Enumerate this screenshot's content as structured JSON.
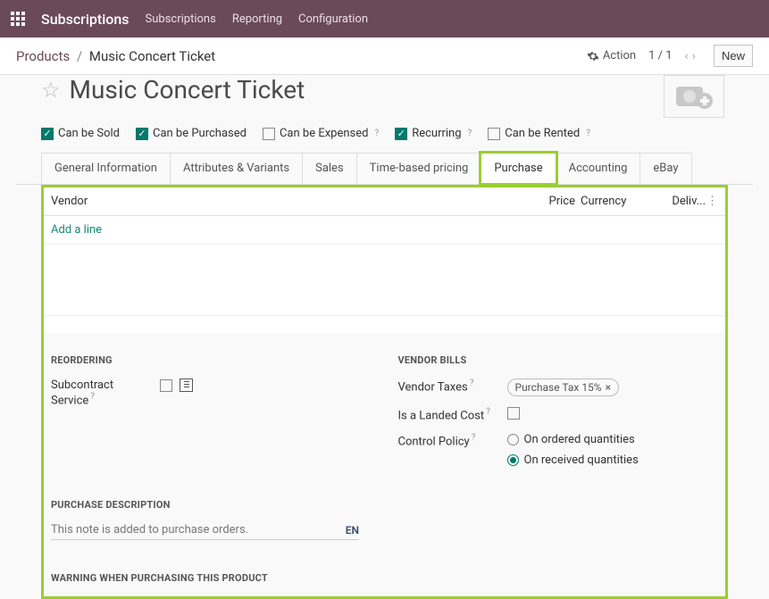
{
  "nav": {
    "app": "Subscriptions",
    "items": [
      "Subscriptions",
      "Reporting",
      "Configuration"
    ]
  },
  "header": {
    "breadcrumb_root": "Products",
    "breadcrumb_current": "Music Concert Ticket",
    "action_label": "Action",
    "pager": "1 / 1",
    "new_label": "New"
  },
  "title": "Music Concert Ticket",
  "checks": {
    "sold": {
      "label": "Can be Sold",
      "checked": true
    },
    "purchased": {
      "label": "Can be Purchased",
      "checked": true
    },
    "expensed": {
      "label": "Can be Expensed",
      "checked": false
    },
    "recurring": {
      "label": "Recurring",
      "checked": true
    },
    "rented": {
      "label": "Can be Rented",
      "checked": false
    }
  },
  "tabs": [
    "General Information",
    "Attributes & Variants",
    "Sales",
    "Time-based pricing",
    "Purchase",
    "Accounting",
    "eBay"
  ],
  "active_tab": "Purchase",
  "vendor_table": {
    "headers": {
      "vendor": "Vendor",
      "price": "Price",
      "currency": "Currency",
      "delivery": "Deliv..."
    },
    "add_label": "Add a line"
  },
  "reordering": {
    "title": "REORDERING",
    "subcontract_label": "Subcontract Service"
  },
  "vendor_bills": {
    "title": "VENDOR BILLS",
    "taxes_label": "Vendor Taxes",
    "taxes_tag": "Purchase Tax 15%",
    "landed_label": "Is a Landed Cost",
    "control_label": "Control Policy",
    "control_opt1": "On ordered quantities",
    "control_opt2": "On received quantities"
  },
  "purchase_desc": {
    "title": "PURCHASE DESCRIPTION",
    "text": "This note is added to purchase orders.",
    "lang": "EN"
  },
  "warning": {
    "title": "WARNING WHEN PURCHASING THIS PRODUCT"
  }
}
